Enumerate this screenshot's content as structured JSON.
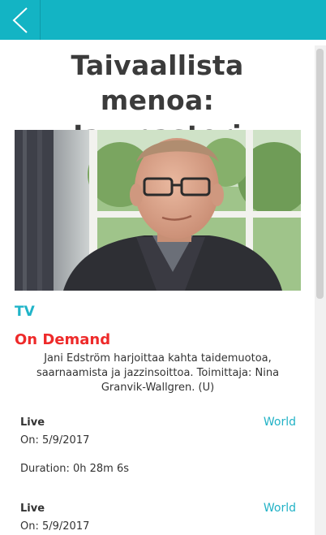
{
  "header": {
    "back_icon": "chevron-left-icon",
    "color": "#13b4c4"
  },
  "program": {
    "title_line1": "Taivaallista menoa:",
    "title_line2": "Jazzpastori",
    "category": "TV",
    "availability": "On Demand",
    "description": "Jani Edström harjoittaa kahta taidemuotoa, saarnaamista ja jazzinsoittoa. Toimittaja: Nina Granvik-Wallgren. (U)"
  },
  "broadcasts": [
    {
      "type": "Live",
      "region": "World",
      "date": "On: 5/9/2017",
      "duration": "Duration: 0h 28m 6s"
    },
    {
      "type": "Live",
      "region": "World",
      "date": "On: 5/9/2017"
    }
  ],
  "colors": {
    "accent": "#20b4c8",
    "on_demand": "#ee2a2a"
  }
}
